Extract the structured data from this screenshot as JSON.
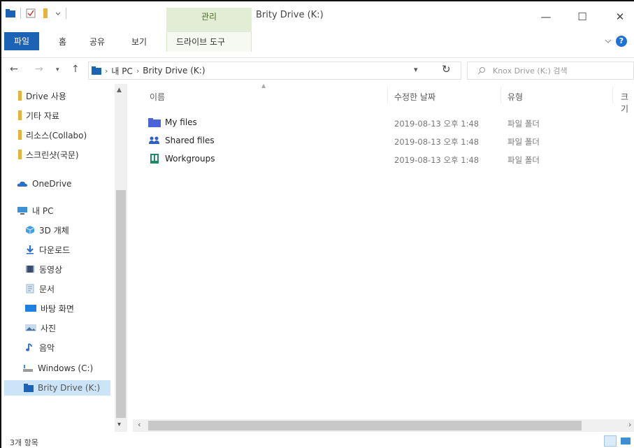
{
  "titlebar": {
    "context_tab_label": "관리",
    "window_title": "Brity Drive (K:)",
    "minimize_glyph": "—",
    "maximize_glyph": "☐",
    "close_glyph": "✕"
  },
  "ribbon": {
    "tabs": [
      {
        "label": "파일"
      },
      {
        "label": "홈"
      },
      {
        "label": "공유"
      },
      {
        "label": "보기"
      },
      {
        "label": "드라이브 도구"
      }
    ],
    "help_glyph": "?"
  },
  "address": {
    "crumbs": [
      "내 PC",
      "Brity Drive (K:)"
    ],
    "search_placeholder": "Knox Drive (K:) 검색"
  },
  "nav": {
    "items": [
      {
        "label": "Drive 사용",
        "icon": "folder-pin-icon"
      },
      {
        "label": "기타 자료",
        "icon": "folder-pin-icon"
      },
      {
        "label": "리소스(Collabo)",
        "icon": "folder-pin-icon"
      },
      {
        "label": "스크린샷(국문)",
        "icon": "folder-pin-icon"
      },
      {
        "label": "OneDrive",
        "icon": "onedrive-cloud-icon"
      },
      {
        "label": "내 PC",
        "icon": "this-pc-icon"
      },
      {
        "label": "3D 개체",
        "icon": "3d-objects-icon"
      },
      {
        "label": "다운로드",
        "icon": "download-icon"
      },
      {
        "label": "동영상",
        "icon": "videos-icon"
      },
      {
        "label": "문서",
        "icon": "documents-icon"
      },
      {
        "label": "바탕 화면",
        "icon": "desktop-icon"
      },
      {
        "label": "사진",
        "icon": "pictures-icon"
      },
      {
        "label": "음악",
        "icon": "music-icon"
      },
      {
        "label": "Windows (C:)",
        "icon": "windows-drive-icon"
      },
      {
        "label": "Brity Drive (K:)",
        "icon": "brity-drive-icon"
      }
    ]
  },
  "content": {
    "columns": [
      "이름",
      "수정한 날짜",
      "유형",
      "크기"
    ],
    "rows": [
      {
        "name": "My files",
        "date": "2019-08-13 오후 1:48",
        "type": "파일 폴더",
        "icon": "my-files-folder-icon"
      },
      {
        "name": "Shared files",
        "date": "2019-08-13 오후 1:48",
        "type": "파일 폴더",
        "icon": "shared-files-icon"
      },
      {
        "name": "Workgroups",
        "date": "2019-08-13 오후 1:48",
        "type": "파일 폴더",
        "icon": "workgroups-icon"
      }
    ]
  },
  "status": {
    "item_count": "3개 항목"
  },
  "colors": {
    "accent": "#1c63b6",
    "context_tab_bg": "#e3ecd5",
    "selection_bg": "#cce4f7",
    "folder_yellow": "#e8b33a"
  }
}
